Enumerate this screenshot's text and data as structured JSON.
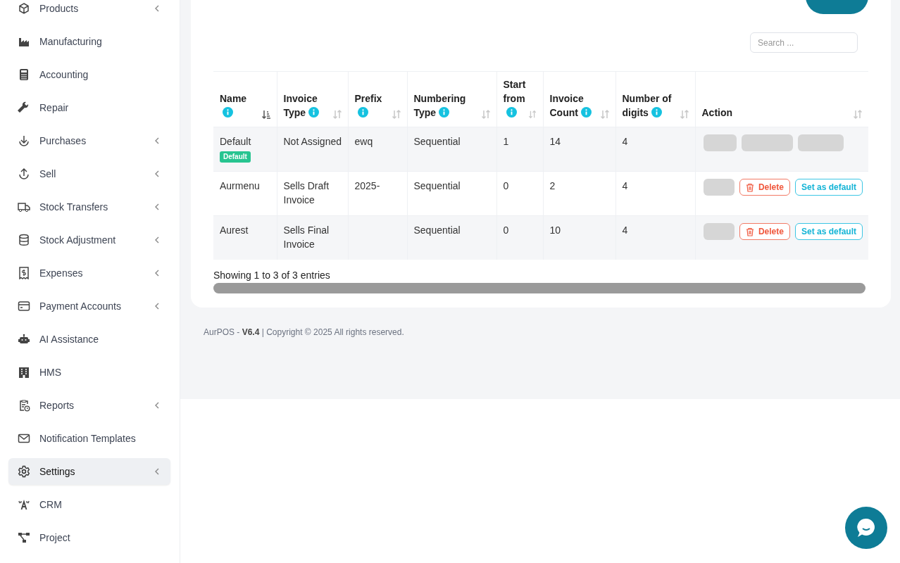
{
  "sidebar": {
    "items": [
      {
        "label": "Products",
        "has_submenu": true,
        "selected": false
      },
      {
        "label": "Manufacturing",
        "has_submenu": false,
        "selected": false
      },
      {
        "label": "Accounting",
        "has_submenu": false,
        "selected": false
      },
      {
        "label": "Repair",
        "has_submenu": false,
        "selected": false
      },
      {
        "label": "Purchases",
        "has_submenu": true,
        "selected": false
      },
      {
        "label": "Sell",
        "has_submenu": true,
        "selected": false
      },
      {
        "label": "Stock Transfers",
        "has_submenu": true,
        "selected": false
      },
      {
        "label": "Stock Adjustment",
        "has_submenu": true,
        "selected": false
      },
      {
        "label": "Expenses",
        "has_submenu": true,
        "selected": false
      },
      {
        "label": "Payment Accounts",
        "has_submenu": true,
        "selected": false
      },
      {
        "label": "AI Assistance",
        "has_submenu": false,
        "selected": false
      },
      {
        "label": "HMS",
        "has_submenu": false,
        "selected": false
      },
      {
        "label": "Reports",
        "has_submenu": true,
        "selected": false
      },
      {
        "label": "Notification Templates",
        "has_submenu": false,
        "selected": false
      },
      {
        "label": "Settings",
        "has_submenu": true,
        "selected": true
      },
      {
        "label": "CRM",
        "has_submenu": false,
        "selected": false
      },
      {
        "label": "Project",
        "has_submenu": false,
        "selected": false
      }
    ]
  },
  "search": {
    "placeholder": "Search ..."
  },
  "table": {
    "columns": [
      {
        "label": "Name",
        "info": true,
        "sorted": true
      },
      {
        "label": "Invoice Type",
        "info": true,
        "sorted": false
      },
      {
        "label": "Prefix",
        "info": true,
        "sorted": false
      },
      {
        "label": "Numbering Type",
        "info": true,
        "sorted": false
      },
      {
        "label": "Start from",
        "info": true,
        "sorted": false
      },
      {
        "label": "Invoice Count",
        "info": true,
        "sorted": false
      },
      {
        "label": "Number of digits",
        "info": true,
        "sorted": false
      },
      {
        "label": "Action",
        "info": false,
        "sorted": false
      }
    ],
    "rows": [
      {
        "name": "Default",
        "badge": "Default",
        "invoice_type": "Not Assigned",
        "prefix": "ewq",
        "numbering_type": "Sequential",
        "start_from": "1",
        "invoice_count": "14",
        "digits": "4",
        "actions": [
          {
            "kind": "placeholder"
          },
          {
            "kind": "placeholder"
          },
          {
            "kind": "placeholder"
          }
        ]
      },
      {
        "name": "Aurmenu",
        "invoice_type": "Sells Draft Invoice",
        "prefix": "2025-",
        "numbering_type": "Sequential",
        "start_from": "0",
        "invoice_count": "2",
        "digits": "4",
        "actions": [
          {
            "kind": "placeholder"
          },
          {
            "kind": "delete",
            "label": "Delete"
          },
          {
            "kind": "set_default",
            "label": "Set as default"
          }
        ]
      },
      {
        "name": "Aurest",
        "invoice_type": "Sells Final Invoice",
        "numbering_type": "Sequential",
        "start_from": "0",
        "invoice_count": "10",
        "digits": "4",
        "actions": [
          {
            "kind": "placeholder"
          },
          {
            "kind": "delete",
            "label": "Delete"
          },
          {
            "kind": "set_default",
            "label": "Set as default"
          }
        ]
      }
    ]
  },
  "table_info": "Showing 1 to 3 of 3 entries",
  "footer": "AurPOS - **V6.4** | Copyright © 2025 All rights reserved."
}
